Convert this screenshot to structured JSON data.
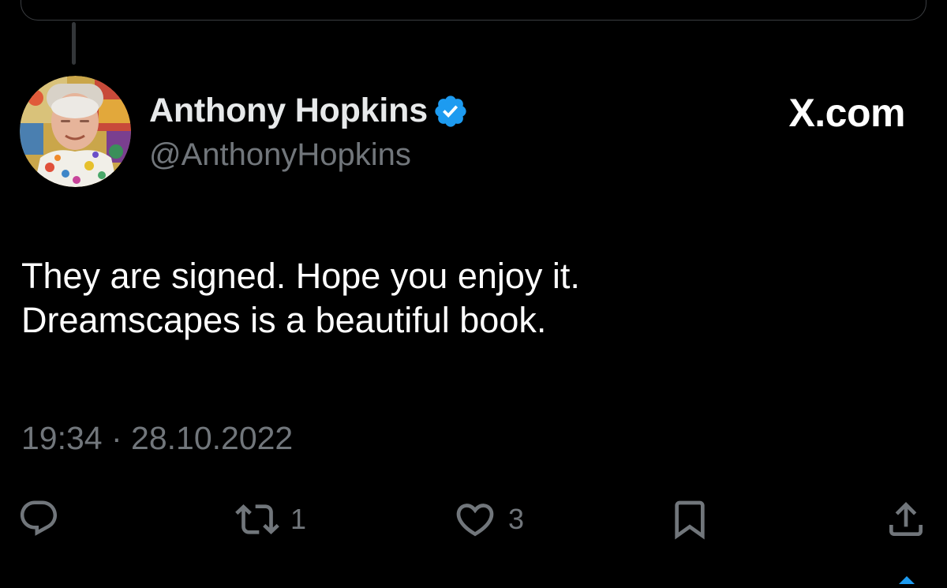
{
  "author": {
    "name": "Anthony Hopkins",
    "handle": "@AnthonyHopkins",
    "verified_color": "#1d9bf0"
  },
  "brand": {
    "label": "X.com"
  },
  "tweet": {
    "lines": [
      "They are signed. Hope you enjoy it.",
      "Dreamscapes is a beautiful book."
    ],
    "timestamp": "19:34 · 28.10.2022"
  },
  "actions": {
    "reply": {
      "icon": "reply-icon"
    },
    "retweet": {
      "icon": "retweet-icon",
      "count": "1"
    },
    "like": {
      "icon": "heart-icon",
      "count": "3"
    },
    "bookmark": {
      "icon": "bookmark-icon"
    },
    "share": {
      "icon": "share-icon"
    }
  },
  "colors": {
    "background": "#000000",
    "primary_text": "#e7e9ea",
    "secondary_text": "#71767b",
    "accent": "#1d9bf0"
  }
}
